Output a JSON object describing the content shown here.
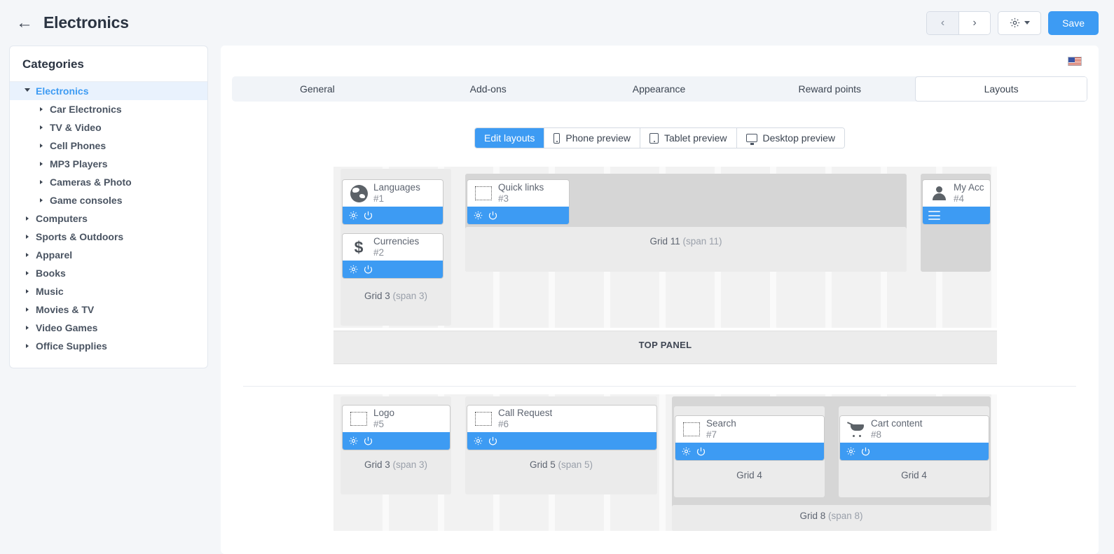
{
  "header": {
    "back_icon": "arrow-left-icon",
    "title": "Electronics",
    "prev_label": "‹",
    "next_label": "›",
    "gear_icon": "gear-icon",
    "save_label": "Save"
  },
  "sidebar": {
    "title": "Categories",
    "items": [
      {
        "label": "Electronics",
        "level": 1,
        "selected": true,
        "expanded": true
      },
      {
        "label": "Car Electronics",
        "level": 2,
        "selected": false,
        "expanded": false
      },
      {
        "label": "TV & Video",
        "level": 2,
        "selected": false,
        "expanded": false
      },
      {
        "label": "Cell Phones",
        "level": 2,
        "selected": false,
        "expanded": false
      },
      {
        "label": "MP3 Players",
        "level": 2,
        "selected": false,
        "expanded": false
      },
      {
        "label": "Cameras & Photo",
        "level": 2,
        "selected": false,
        "expanded": false
      },
      {
        "label": "Game consoles",
        "level": 2,
        "selected": false,
        "expanded": false
      },
      {
        "label": "Computers",
        "level": 1,
        "selected": false,
        "expanded": false
      },
      {
        "label": "Sports & Outdoors",
        "level": 1,
        "selected": false,
        "expanded": false
      },
      {
        "label": "Apparel",
        "level": 1,
        "selected": false,
        "expanded": false
      },
      {
        "label": "Books",
        "level": 1,
        "selected": false,
        "expanded": false
      },
      {
        "label": "Music",
        "level": 1,
        "selected": false,
        "expanded": false
      },
      {
        "label": "Movies & TV",
        "level": 1,
        "selected": false,
        "expanded": false
      },
      {
        "label": "Video Games",
        "level": 1,
        "selected": false,
        "expanded": false
      },
      {
        "label": "Office Supplies",
        "level": 1,
        "selected": false,
        "expanded": false
      }
    ]
  },
  "language_flag": "us-flag-icon",
  "tabs": [
    {
      "label": "General",
      "active": false
    },
    {
      "label": "Add-ons",
      "active": false
    },
    {
      "label": "Appearance",
      "active": false
    },
    {
      "label": "Reward points",
      "active": false
    },
    {
      "label": "Layouts",
      "active": true
    }
  ],
  "preview_modes": [
    {
      "label": "Edit layouts",
      "icon": "",
      "active": true
    },
    {
      "label": "Phone preview",
      "icon": "phone-icon",
      "active": false
    },
    {
      "label": "Tablet preview",
      "icon": "tablet-icon",
      "active": false
    },
    {
      "label": "Desktop preview",
      "icon": "desktop-icon",
      "active": false
    }
  ],
  "layout": {
    "top_panel_label": "TOP PANEL",
    "grid_labels": {
      "grid3_span3": {
        "name": "Grid 3",
        "span": "(span 3)"
      },
      "grid11_span11": {
        "name": "Grid 11",
        "span": "(span 11)"
      },
      "grid5_span5": {
        "name": "Grid 5",
        "span": "(span 5)"
      },
      "grid4_a": {
        "name": "Grid 4",
        "span": ""
      },
      "grid4_b": {
        "name": "Grid 4",
        "span": ""
      },
      "grid8_span8": {
        "name": "Grid 8",
        "span": "(span 8)"
      }
    },
    "blocks": [
      {
        "name": "Languages",
        "number": "#1",
        "icon": "globe-icon",
        "actions": [
          "gear-icon",
          "power-icon"
        ]
      },
      {
        "name": "Currencies",
        "number": "#2",
        "icon": "dollar-icon",
        "actions": [
          "gear-icon",
          "power-icon"
        ]
      },
      {
        "name": "Quick links",
        "number": "#3",
        "icon": "placeholder-icon",
        "actions": [
          "gear-icon",
          "power-icon"
        ]
      },
      {
        "name": "My Accou",
        "number": "#4",
        "icon": "person-icon",
        "actions": [
          "menu-icon"
        ]
      },
      {
        "name": "Logo",
        "number": "#5",
        "icon": "placeholder-icon",
        "actions": [
          "gear-icon",
          "power-icon"
        ]
      },
      {
        "name": "Call Request",
        "number": "#6",
        "icon": "placeholder-icon",
        "actions": [
          "gear-icon",
          "power-icon"
        ]
      },
      {
        "name": "Search",
        "number": "#7",
        "icon": "placeholder-icon",
        "actions": [
          "gear-icon",
          "power-icon"
        ]
      },
      {
        "name": "Cart content",
        "number": "#8",
        "icon": "cart-icon",
        "actions": [
          "gear-icon",
          "power-icon"
        ]
      }
    ]
  },
  "colors": {
    "accent": "#3d9bf3",
    "page_bg": "#f4f6f9",
    "panel_bg": "#ffffff",
    "holder_bg": "#ebebeb",
    "selected_item": "#e9f2fd"
  }
}
